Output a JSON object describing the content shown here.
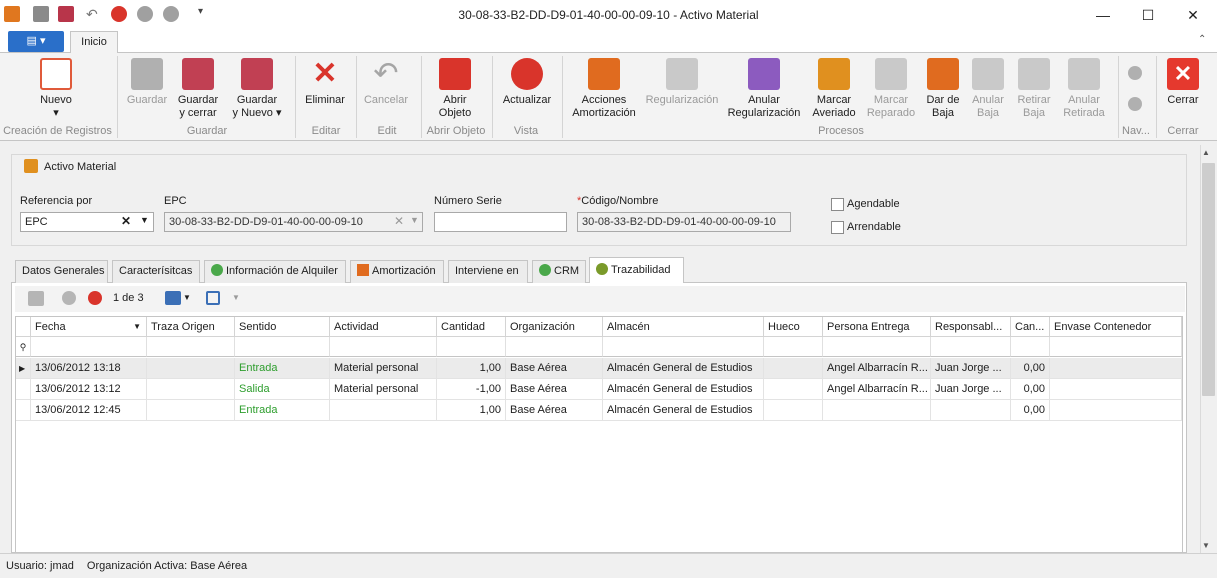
{
  "window": {
    "title": "30-08-33-B2-DD-D9-01-40-00-00-09-10 - Activo Material"
  },
  "ribbon_tabs": {
    "inicio": "Inicio"
  },
  "ribbon": {
    "nuevo": "Nuevo",
    "guardar": "Guardar",
    "guardar_cerrar": [
      "Guardar",
      "y cerrar"
    ],
    "guardar_nuevo": [
      "Guardar",
      "y Nuevo"
    ],
    "eliminar": "Eliminar",
    "cancelar": "Cancelar",
    "abrir_objeto": [
      "Abrir",
      "Objeto"
    ],
    "actualizar": "Actualizar",
    "acciones_amortizacion": [
      "Acciones",
      "Amortización"
    ],
    "regularizacion": "Regularización",
    "anular_regularizacion": [
      "Anular",
      "Regularización"
    ],
    "marcar_averiado": [
      "Marcar",
      "Averiado"
    ],
    "marcar_reparado": [
      "Marcar",
      "Reparado"
    ],
    "dar_baja": [
      "Dar de",
      "Baja"
    ],
    "anular_baja": [
      "Anular",
      "Baja"
    ],
    "retirar_baja": [
      "Retirar",
      "Baja"
    ],
    "anular_retirada": [
      "Anular",
      "Retirada"
    ],
    "cerrar": "Cerrar",
    "groups": {
      "creacion": "Creación de Registros",
      "guardar": "Guardar",
      "editar": "Editar",
      "edit": "Edit",
      "abrir_objeto": "Abrir Objeto",
      "vista": "Vista",
      "procesos": "Procesos",
      "nav": "Nav...",
      "cerrar": "Cerrar"
    }
  },
  "panel": {
    "title": "Activo Material",
    "referencia_label": "Referencia por",
    "referencia_value": "EPC",
    "epc_label": "EPC",
    "epc_value": "30-08-33-B2-DD-D9-01-40-00-00-09-10",
    "numero_serie_label": "Número Serie",
    "numero_serie_value": "",
    "codigo_label": "Código/Nombre",
    "codigo_required": "*",
    "codigo_value": "30-08-33-B2-DD-D9-01-40-00-00-09-10",
    "agendable": "Agendable",
    "arrendable": "Arrendable"
  },
  "tabs": [
    "Datos Generales",
    "Caracterísitcas",
    "Información de Alquiler",
    "Amortización",
    "Interviene en",
    "CRM",
    "Trazabilidad"
  ],
  "grid_toolbar": {
    "pager": "1 de 3"
  },
  "grid": {
    "columns": [
      "Fecha",
      "Traza Origen",
      "Sentido",
      "Actividad",
      "Cantidad",
      "Organización",
      "Almacén",
      "Hueco",
      "Persona Entrega",
      "Responsabl...",
      "Can...",
      "Envase Contenedor"
    ],
    "rows": [
      {
        "fecha": "13/06/2012 13:18",
        "traza": "",
        "sentido": "Entrada",
        "actividad": "Material personal",
        "cantidad": "1,00",
        "organizacion": "Base Aérea",
        "almacen": "Almacén General de Estudios",
        "hueco": "",
        "persona": "Angel Albarracín R...",
        "responsable": "Juan Jorge ...",
        "can": "0,00",
        "envase": ""
      },
      {
        "fecha": "13/06/2012 13:12",
        "traza": "",
        "sentido": "Salida",
        "actividad": "Material personal",
        "cantidad": "-1,00",
        "organizacion": "Base Aérea",
        "almacen": "Almacén General de Estudios",
        "hueco": "",
        "persona": "Angel Albarracín R...",
        "responsable": "Juan Jorge ...",
        "can": "0,00",
        "envase": ""
      },
      {
        "fecha": "13/06/2012 12:45",
        "traza": "",
        "sentido": "Entrada",
        "actividad": "",
        "cantidad": "1,00",
        "organizacion": "Base Aérea",
        "almacen": "Almacén General de Estudios",
        "hueco": "",
        "persona": "",
        "responsable": "",
        "can": "0,00",
        "envase": ""
      }
    ]
  },
  "status": {
    "usuario": "Usuario: jmad",
    "organizacion": "Organización Activa: Base Aérea"
  },
  "colors": {
    "accent": "#2a6fc9",
    "green_text": "#2e9e2e",
    "red_icon": "#d9342b",
    "orange_icon": "#e06b1f"
  }
}
